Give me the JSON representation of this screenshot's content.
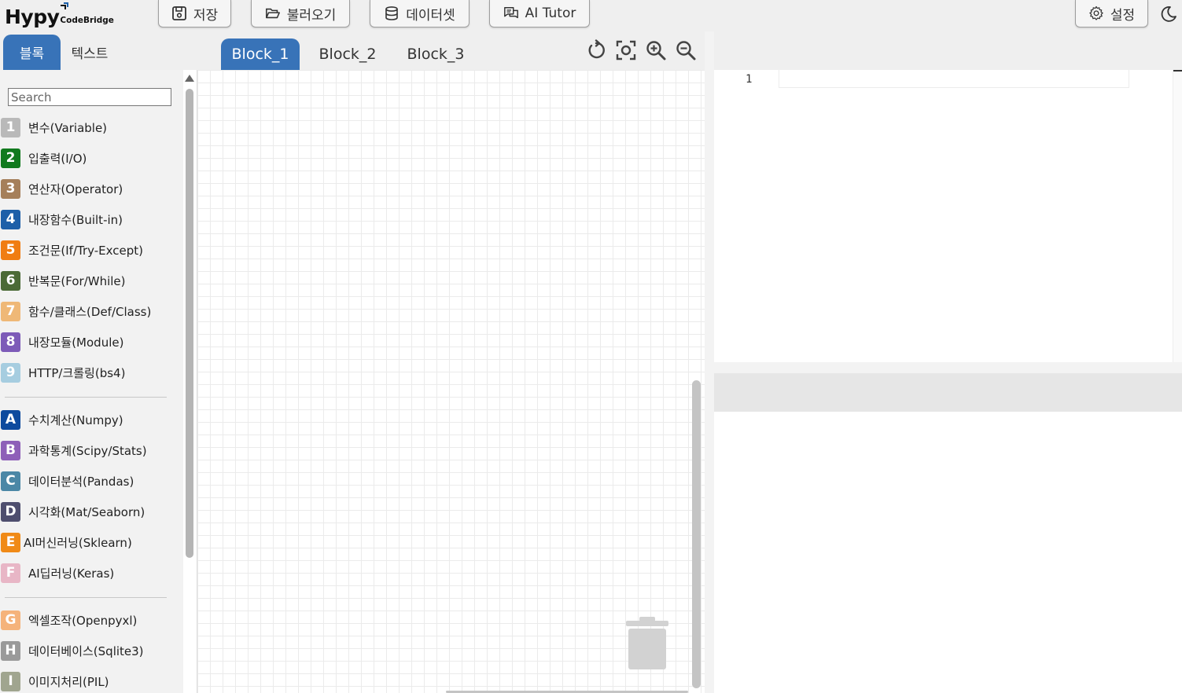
{
  "logo": {
    "main": "Hypy",
    "sub": "CodeBridge"
  },
  "toolbar": {
    "save": "저장",
    "load": "불러오기",
    "dataset": "데이터셋",
    "ai_tutor": "AI Tutor",
    "settings": "설정"
  },
  "left_tabs": {
    "blocks": "블록",
    "text": "텍스트"
  },
  "toolbox": {
    "search_placeholder": "Search",
    "categories": [
      {
        "badge": "1",
        "label": "변수(Variable)",
        "color": "#b9b9b9"
      },
      {
        "badge": "2",
        "label": "입출력(I/O)",
        "color": "#117a1e"
      },
      {
        "badge": "3",
        "label": "연산자(Operator)",
        "color": "#a57f5a"
      },
      {
        "badge": "4",
        "label": "내장함수(Built-in)",
        "color": "#1d5fa8"
      },
      {
        "badge": "5",
        "label": "조건문(If/Try-Except)",
        "color": "#f07d12"
      },
      {
        "badge": "6",
        "label": "반복문(For/While)",
        "color": "#4b6a36"
      },
      {
        "badge": "7",
        "label": "함수/클래스(Def/Class)",
        "color": "#efb877"
      },
      {
        "badge": "8",
        "label": "내장모듈(Module)",
        "color": "#7d5bb8"
      },
      {
        "badge": "9",
        "label": "HTTP/크롤링(bs4)",
        "color": "#a6cde0"
      },
      {
        "badge": "A",
        "label": "수치계산(Numpy)",
        "color": "#0d4a9e"
      },
      {
        "badge": "B",
        "label": "과학통계(Scipy/Stats)",
        "color": "#8e5fb8"
      },
      {
        "badge": "C",
        "label": "데이터분석(Pandas)",
        "color": "#4b87a6"
      },
      {
        "badge": "D",
        "label": "시각화(Mat/Seaborn)",
        "color": "#4e4e6e"
      },
      {
        "badge": "E",
        "label": "AI머신러닝(Sklearn)",
        "color": "#f08a17"
      },
      {
        "badge": "F",
        "label": "AI딥러닝(Keras)",
        "color": "#e8b6c6"
      },
      {
        "badge": "G",
        "label": "엑셀조작(Openpyxl)",
        "color": "#f5b37b"
      },
      {
        "badge": "H",
        "label": "데이터베이스(Sqlite3)",
        "color": "#9a9a9a"
      },
      {
        "badge": "I",
        "label": "이미지처리(PIL)",
        "color": "#a0a58f"
      }
    ]
  },
  "workspace": {
    "tabs": [
      "Block_1",
      "Block_2",
      "Block_3"
    ],
    "active_tab": "Block_1"
  },
  "editor": {
    "line_numbers": [
      "1"
    ]
  },
  "colors": {
    "accent": "#3873b8",
    "toolbar_bg": "#efefef"
  }
}
